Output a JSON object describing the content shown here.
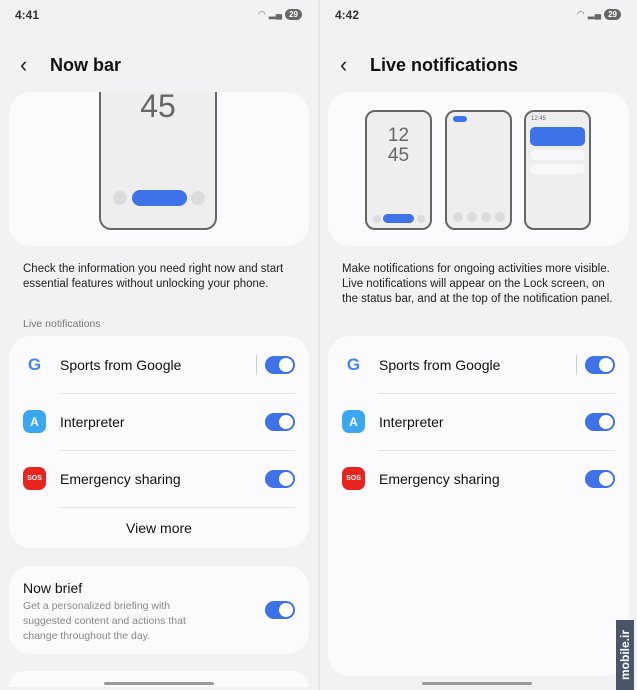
{
  "left": {
    "status_time": "4:41",
    "battery": "29",
    "title": "Now bar",
    "illustration_clock": "45",
    "description": "Check the information you need right now and start essential features without unlocking your phone.",
    "section_label": "Live notifications",
    "items": [
      {
        "label": "Sports from Google",
        "icon": "google-icon",
        "enabled": true
      },
      {
        "label": "Interpreter",
        "icon": "interpreter-icon",
        "enabled": true
      },
      {
        "label": "Emergency sharing",
        "icon": "sos-icon",
        "enabled": true
      }
    ],
    "view_more": "View more",
    "now_brief": {
      "title": "Now brief",
      "subtitle": "Get a personalized briefing with suggested content and actions that change throughout the day.",
      "enabled": true
    }
  },
  "right": {
    "status_time": "4:42",
    "battery": "29",
    "title": "Live notifications",
    "illustration_clock_hour": "12",
    "illustration_clock_min": "45",
    "illustration_time": "12:45",
    "description": "Make notifications for ongoing activities more visible. Live notifications will appear on the Lock screen, on the status bar, and at the top of the notification panel.",
    "items": [
      {
        "label": "Sports from Google",
        "icon": "google-icon",
        "enabled": true
      },
      {
        "label": "Interpreter",
        "icon": "interpreter-icon",
        "enabled": true
      },
      {
        "label": "Emergency sharing",
        "icon": "sos-icon",
        "enabled": true
      }
    ]
  },
  "watermark": "mobile.ir",
  "colors": {
    "accent": "#3e72e8",
    "background": "#f2f2f4",
    "card": "#fbfbfd"
  }
}
